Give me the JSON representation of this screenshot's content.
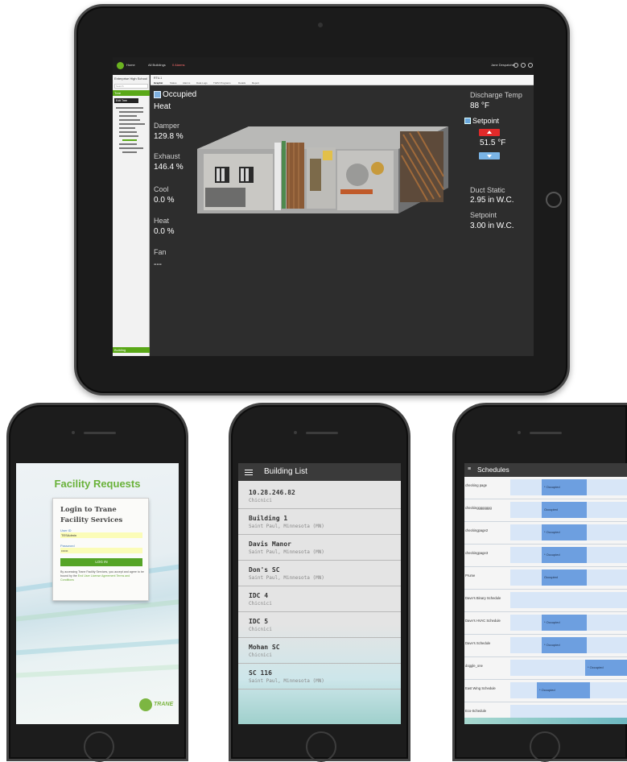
{
  "tablet": {
    "site_name": "Enterprise High School",
    "search_placeholder": "Search",
    "nav_tree_button": "Tree",
    "edit_tree_button": "Edit Tree",
    "building_button": "Building",
    "unit_label": "RTU-1",
    "tabs": [
      "Graphic",
      "Status",
      "Alarms",
      "Data Logs",
      "TGP2 Programs",
      "Details",
      "Report"
    ],
    "topbar": {
      "brand": "Home",
      "link1": "All Buildings",
      "link2": "0 Alarms",
      "user": "Jane Despatcher"
    },
    "left_panel": {
      "occupancy": "Occupied",
      "mode": "Heat",
      "damper_label": "Damper",
      "damper_value": "129.8 %",
      "exhaust_label": "Exhaust",
      "exhaust_value": "146.4 %",
      "cool_label": "Cool",
      "cool_value": "0.0 %",
      "heat_label": "Heat",
      "heat_value": "0.0 %",
      "fan_label": "Fan",
      "fan_value": "---"
    },
    "right_panel": {
      "discharge_label": "Discharge Temp",
      "discharge_value": "88 °F",
      "setpoint_label": "Setpoint",
      "setpoint_value": "51.5 °F",
      "duct_static_label": "Duct Static",
      "duct_static_value": "2.95 in W.C.",
      "setpoint2_label": "Setpoint",
      "setpoint2_value": "3.00 in W.C."
    }
  },
  "phone1": {
    "title": "Facility Requests",
    "card_heading": "Login to Trane Facility Services",
    "user_id_label": "User ID",
    "user_id_value": "TESAdmin",
    "password_label": "Password",
    "password_value": "••••••",
    "login_button": "LOG IN",
    "legal_text": "By accessing Trane Facility Services, you accept and agree to be bound by the",
    "legal_link": "End User License Agreement Terms and Conditions",
    "logo_text": "TRANE"
  },
  "phone2": {
    "title": "Building List",
    "buildings": [
      {
        "name": "10.28.246.82",
        "location": "Chicnici"
      },
      {
        "name": "Building 1",
        "location": "Saint Paul, Minnesota (MN)"
      },
      {
        "name": "Davis Manor",
        "location": "Saint Paul, Minnesota (MN)"
      },
      {
        "name": "Don's SC",
        "location": "Saint Paul, Minnesota (MN)"
      },
      {
        "name": "IDC 4",
        "location": "Chicnici"
      },
      {
        "name": "IDC 5",
        "location": "Chicnici"
      },
      {
        "name": "Mohan SC",
        "location": "Chicnici"
      },
      {
        "name": "SC 116",
        "location": "Saint Paul, Minnesota (MN)"
      }
    ]
  },
  "phone3": {
    "title": "Schedules",
    "rows": [
      {
        "name": "checking page",
        "status": "* Occupied"
      },
      {
        "name": "checkingggggggg",
        "status": "Occupied"
      },
      {
        "name": "checkingpage2",
        "status": "* Occupied"
      },
      {
        "name": "checkingpage3",
        "status": "* Occupied"
      },
      {
        "name": "Prume",
        "status": "Occupied"
      },
      {
        "name": "Dave's Binary Schedule",
        "status": ""
      },
      {
        "name": "Dave's HVAC Schedule",
        "status": "* Occupied"
      },
      {
        "name": "Dave's Schedule",
        "status": "* Occupied"
      },
      {
        "name": "doggle_one",
        "status": "* Occupied"
      },
      {
        "name": "East Wing Schedule",
        "status": "* Occupied"
      },
      {
        "name": "Eco-Schedule",
        "status": ""
      },
      {
        "name": "efferty",
        "status": "Occupied"
      }
    ]
  },
  "colors": {
    "trane_green": "#6ab23a",
    "alert_red": "#e22a2a",
    "occupied_blue": "#6d9fe0"
  }
}
